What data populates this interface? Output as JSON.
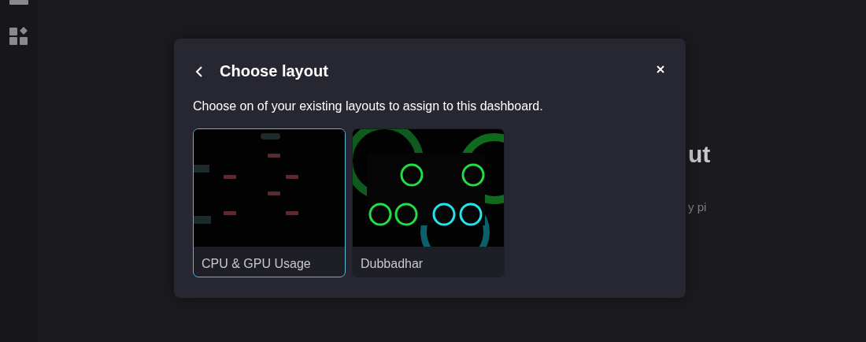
{
  "background": {
    "heading": "ut",
    "text": "y pi"
  },
  "modal": {
    "title": "Choose layout",
    "description": "Choose on of your existing layouts to assign to this dashboard.",
    "layouts": [
      {
        "name": "CPU & GPU Usage",
        "selected": true
      },
      {
        "name": "Dubbadhar",
        "selected": false
      }
    ]
  }
}
